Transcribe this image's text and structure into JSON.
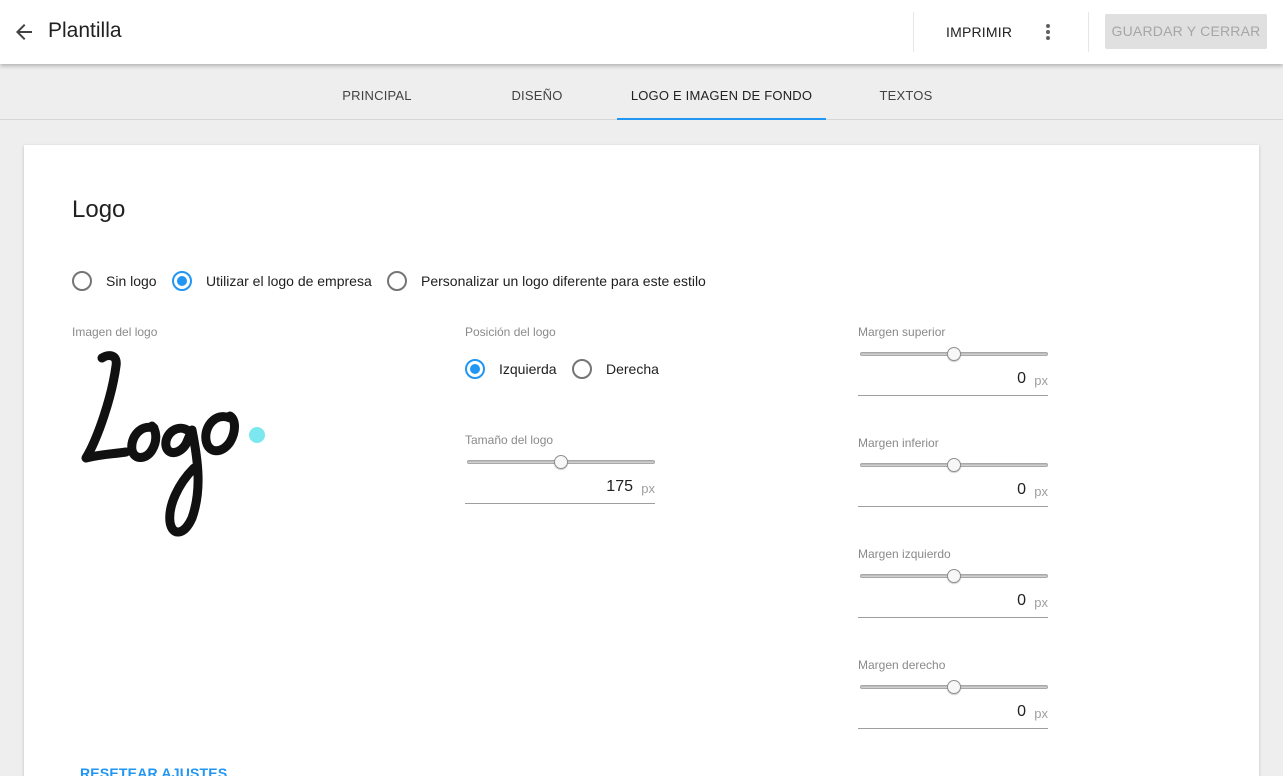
{
  "header": {
    "title": "Plantilla",
    "print_label": "IMPRIMIR",
    "save_label": "GUARDAR Y CERRAR"
  },
  "tabs": [
    {
      "label": "PRINCIPAL",
      "active": false
    },
    {
      "label": "DISEÑO",
      "active": false
    },
    {
      "label": "LOGO E IMAGEN DE FONDO",
      "active": true
    },
    {
      "label": "TEXTOS",
      "active": false
    }
  ],
  "colors": {
    "accent": "#2196f3"
  },
  "logo_section": {
    "title": "Logo",
    "options": [
      {
        "label": "Sin logo",
        "selected": false
      },
      {
        "label": "Utilizar el logo de empresa",
        "selected": true
      },
      {
        "label": "Personalizar un logo diferente para este estilo",
        "selected": false
      }
    ],
    "image_label": "Imagen del logo",
    "position": {
      "label": "Posición del logo",
      "options": [
        {
          "label": "Izquierda",
          "selected": true
        },
        {
          "label": "Derecha",
          "selected": false
        }
      ]
    },
    "size": {
      "label": "Tamaño del logo",
      "value": "175",
      "unit": "px",
      "slider_fraction": 0.5
    },
    "margins": [
      {
        "label": "Margen superior",
        "value": "0",
        "unit": "px",
        "slider_fraction": 0.5
      },
      {
        "label": "Margen inferior",
        "value": "0",
        "unit": "px",
        "slider_fraction": 0.5
      },
      {
        "label": "Margen izquierdo",
        "value": "0",
        "unit": "px",
        "slider_fraction": 0.5
      },
      {
        "label": "Margen derecho",
        "value": "0",
        "unit": "px",
        "slider_fraction": 0.5
      }
    ],
    "reset_label": "RESETEAR AJUSTES"
  }
}
